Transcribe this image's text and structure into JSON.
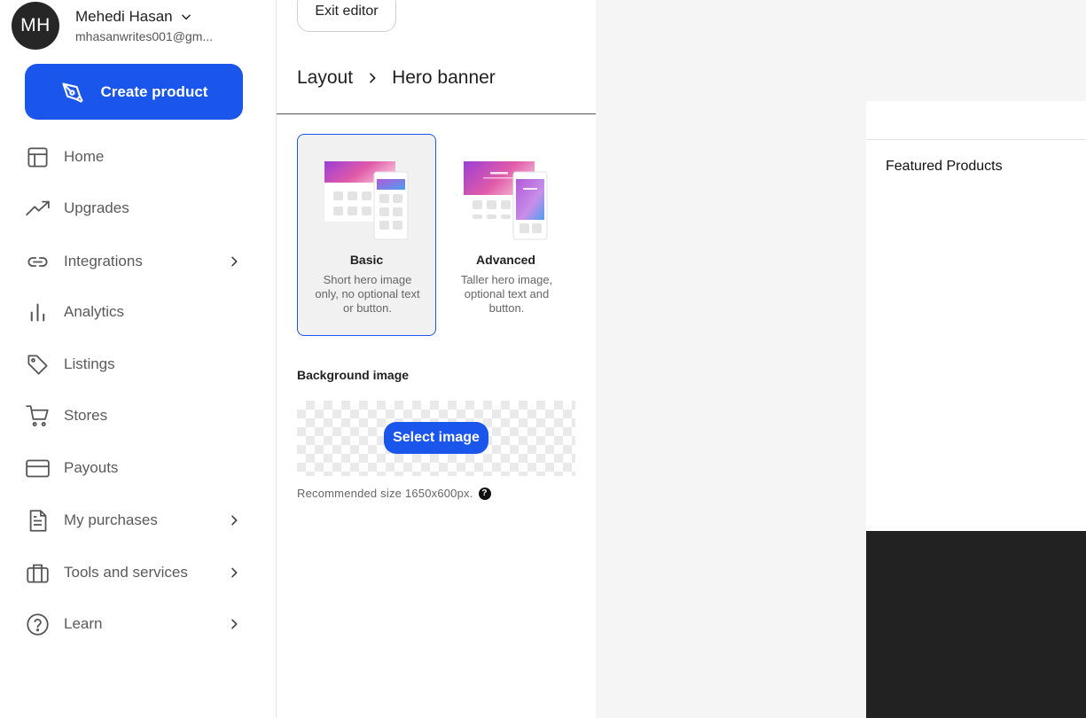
{
  "user": {
    "initials": "MH",
    "name": "Mehedi Hasan",
    "email": "mhasanwrites001@gm..."
  },
  "sidebar": {
    "create_label": "Create product",
    "items": [
      {
        "label": "Home",
        "icon": "layout-icon",
        "has_chevron": false
      },
      {
        "label": "Upgrades",
        "icon": "trending-up-icon",
        "has_chevron": false
      },
      {
        "label": "Integrations",
        "icon": "link-icon",
        "has_chevron": true
      },
      {
        "label": "Analytics",
        "icon": "bar-chart-icon",
        "has_chevron": false
      },
      {
        "label": "Listings",
        "icon": "tag-icon",
        "has_chevron": false
      },
      {
        "label": "Stores",
        "icon": "cart-icon",
        "has_chevron": false
      },
      {
        "label": "Payouts",
        "icon": "credit-card-icon",
        "has_chevron": false
      },
      {
        "label": "My purchases",
        "icon": "document-icon",
        "has_chevron": true
      },
      {
        "label": "Tools and services",
        "icon": "briefcase-icon",
        "has_chevron": true
      },
      {
        "label": "Learn",
        "icon": "question-circle-icon",
        "has_chevron": true
      }
    ]
  },
  "editor": {
    "exit_label": "Exit editor",
    "breadcrumb": [
      "Layout",
      "Hero banner"
    ],
    "layouts": [
      {
        "title": "Basic",
        "description": "Short hero image only, no optional text or button.",
        "selected": true
      },
      {
        "title": "Advanced",
        "description": "Taller hero image, optional text and button.",
        "selected": false
      }
    ],
    "background_label": "Background image",
    "select_image_label": "Select image",
    "recommended_size": "Recommended size 1650x600px.",
    "help_glyph": "?"
  },
  "preview": {
    "section_title": "Featured Products"
  },
  "colors": {
    "accent": "#1a56ec",
    "footer": "#222222",
    "preview_bg": "#f5f5f6"
  }
}
